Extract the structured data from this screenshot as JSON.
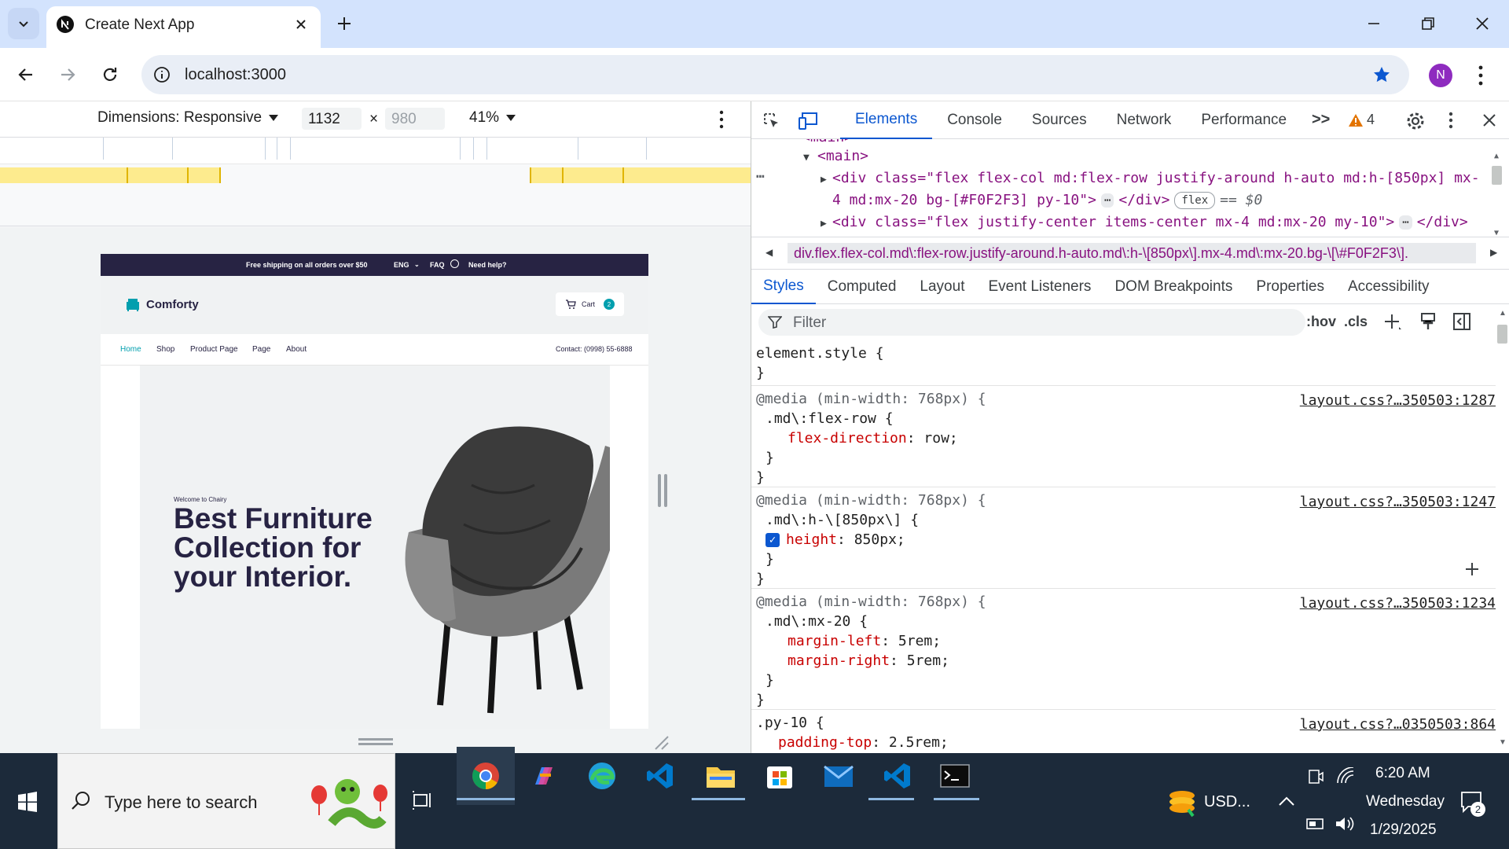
{
  "browser": {
    "tab_title": "Create Next App",
    "url": "localhost:3000",
    "profile_initial": "N",
    "accent": "#d3e3fd"
  },
  "device_toolbar": {
    "dimensions_label": "Dimensions: Responsive",
    "width": "1132",
    "times": "×",
    "height_placeholder": "980",
    "zoom": "41%"
  },
  "emulated_page": {
    "announcement": "Free shipping on all orders over $50",
    "lang": "ENG",
    "faq": "FAQ",
    "help": "Need help?",
    "brand": "Comforty",
    "cart_label": "Cart",
    "cart_count": "2",
    "nav": [
      "Home",
      "Shop",
      "Product Page",
      "Page",
      "About"
    ],
    "contact": "Contact: (0998) 55-6888",
    "hero_kicker": "Welcome to Chairy",
    "hero_title": "Best Furniture Collection for your Interior."
  },
  "devtools": {
    "tabs": [
      "Elements",
      "Console",
      "Sources",
      "Network",
      "Performance"
    ],
    "active_tab": "Elements",
    "more_tabs": ">>",
    "warning_count": "4",
    "dom": {
      "line0": "<main>",
      "line1": "<main>",
      "line2_open": "<div class=\"flex flex-col md:flex-row justify-around h-auto md:h-[850px] mx-",
      "line3": "4 md:mx-20 bg-[#F0F2F3] py-10\">",
      "line3_close": "</div>",
      "flex_badge": "flex",
      "dollar0": "== $0",
      "line4": "<div class=\"flex justify-center items-center mx-4 md:mx-20 my-10\">",
      "line4_close": "</div>"
    },
    "breadcrumb": "div.flex.flex-col.md\\:flex-row.justify-around.h-auto.md\\:h-\\[850px\\].mx-4.md\\:mx-20.bg-\\[\\#F0F2F3\\].",
    "sub_tabs": [
      "Styles",
      "Computed",
      "Layout",
      "Event Listeners",
      "DOM Breakpoints",
      "Properties",
      "Accessibility"
    ],
    "filter_placeholder": "Filter",
    "hov": ":hov",
    "cls": ".cls",
    "rules": [
      {
        "media": "",
        "selector": "element.style {",
        "src": "",
        "props": []
      },
      {
        "media": "@media (min-width: 768px) {",
        "selector": ".md\\:flex-row {",
        "src": "layout.css?…350503:1287",
        "props": [
          {
            "name": "flex-direction",
            "value": "row;"
          }
        ]
      },
      {
        "media": "@media (min-width: 768px) {",
        "selector": ".md\\:h-\\[850px\\] {",
        "src": "layout.css?…350503:1247",
        "props": [
          {
            "name": "height",
            "value": "850px;",
            "checked": true
          }
        ]
      },
      {
        "media": "@media (min-width: 768px) {",
        "selector": ".md\\:mx-20 {",
        "src": "layout.css?…350503:1234",
        "props": [
          {
            "name": "margin-left",
            "value": "5rem;"
          },
          {
            "name": "margin-right",
            "value": "5rem;"
          }
        ]
      },
      {
        "media": "",
        "selector": ".py-10 {",
        "src": "layout.css?…0350503:864",
        "props": [
          {
            "name": "padding-top",
            "value": "2.5rem;"
          }
        ]
      }
    ]
  },
  "taskbar": {
    "search_placeholder": "Type here to search",
    "tray_app": "USD...",
    "time": "6:20 AM",
    "day": "Wednesday",
    "date": "1/29/2025",
    "notifications": "2"
  }
}
